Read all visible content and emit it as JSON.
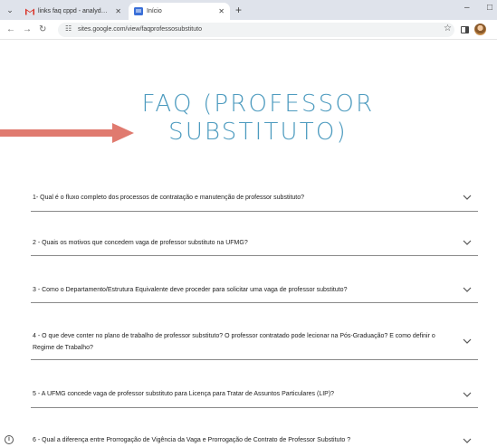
{
  "browser": {
    "tabs": [
      {
        "title": "links faq cppd - analydaco@g",
        "active": false
      },
      {
        "title": "Início",
        "active": true
      }
    ],
    "url": "sites.google.com/view/faqprofessosubstituto",
    "window_controls": [
      "–",
      "□"
    ]
  },
  "page": {
    "title_line1": "FAQ (PROFESSOR",
    "title_line2": "SUBSTITUTO)",
    "accent_color": "#4d9bbf",
    "arrow_color": "#e07a6f"
  },
  "faq": [
    {
      "question": "1- Qual é o fluxo completo dos processos de contratação e manutenção de professor substituto?"
    },
    {
      "question": "2 - Quais os motivos que concedem vaga de professor substituto na UFMG?"
    },
    {
      "question": "3 - Como o Departamento/Estrutura Equivalente deve proceder para solicitar uma vaga de professor substituto?"
    },
    {
      "question": "4 - O que deve conter no plano de trabalho de professor substituto? O professor contratado pode lecionar na Pós-Graduação? E como definir o Regime de Trabalho?"
    },
    {
      "question": "5 - A UFMG concede vaga de professor substituto para Licença para Tratar de Assuntos Particulares  (LIP)?"
    },
    {
      "question": "6 - Qual a diferença entre Prorrogação de Vigência da Vaga e Prorrogação de Contrato de Professor Substituto ?"
    }
  ]
}
